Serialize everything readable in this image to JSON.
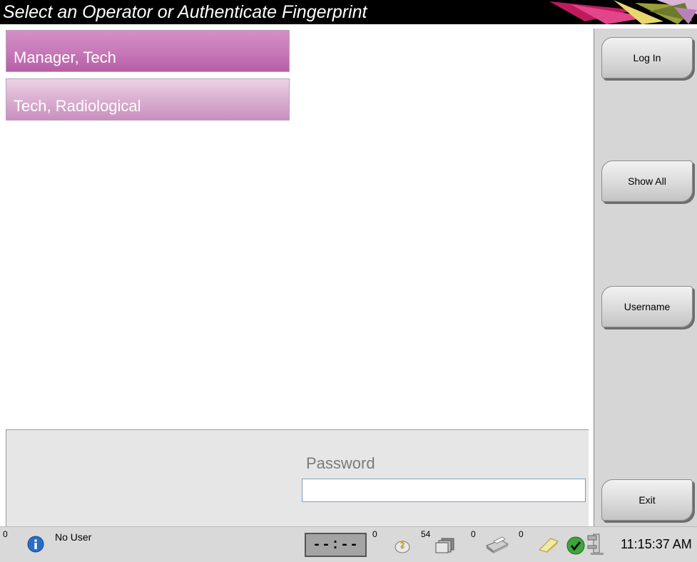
{
  "title": "Select an Operator or Authenticate Fingerprint",
  "operators": [
    {
      "name": "Manager, Tech",
      "selected": true
    },
    {
      "name": "Tech, Radiological",
      "selected": false
    }
  ],
  "side_buttons": {
    "log_in": "Log In",
    "show_all": "Show All",
    "username": "Username",
    "exit": "Exit"
  },
  "password": {
    "label": "Password",
    "value": ""
  },
  "status": {
    "alerts_count": "0",
    "user": "No User",
    "timer": "--:--",
    "queries_count": "0",
    "scans_count": "54",
    "prints_count": "0",
    "notes_count": "0",
    "time": "11:15:37 AM"
  },
  "icons": {
    "info": "info-icon",
    "query": "question-disc-icon",
    "scans": "image-stack-icon",
    "printer": "printer-icon",
    "notes": "note-icon",
    "system_ok": "checkmark-icon",
    "gantry": "gantry-icon"
  },
  "colors": {
    "operator_selected": "#c777b8",
    "operator_normal": "#dcb3d2",
    "side_panel": "#d6d6d6",
    "title_bg": "#000000"
  }
}
